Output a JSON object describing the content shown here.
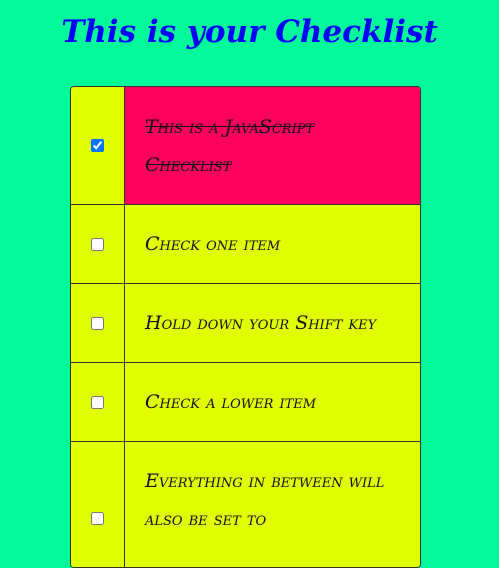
{
  "page": {
    "title": "This is your Checklist"
  },
  "colors": {
    "background": "#00fa9a",
    "title": "#0000ff",
    "item_background": "#e0ff00",
    "checked_item_background": "#ff005e"
  },
  "items": [
    {
      "label": "This is a JavaScript Checklist",
      "checked": true
    },
    {
      "label": "Check one item",
      "checked": false
    },
    {
      "label": "Hold down your Shift key",
      "checked": false
    },
    {
      "label": "Check a lower item",
      "checked": false
    },
    {
      "label": "Everything in between will also be set to",
      "checked": false
    }
  ]
}
